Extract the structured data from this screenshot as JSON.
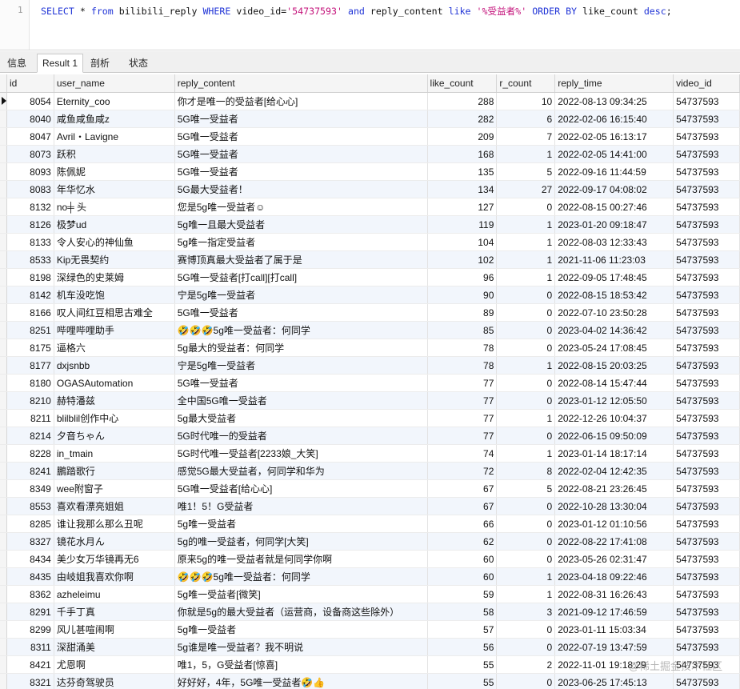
{
  "editor": {
    "line_number": "1",
    "sql": {
      "select": "SELECT",
      "star": " * ",
      "from": "from",
      "table": " bilibili_reply ",
      "where": "WHERE",
      "cond1": " video_id=",
      "vid": "'54737593'",
      "and": " and",
      "cond2": " reply_content ",
      "like": "like",
      "pattern": " '%受益者%'",
      "order": " ORDER BY",
      "orderby": " like_count ",
      "desc": "desc",
      "end": ";"
    }
  },
  "tabs": [
    "信息",
    "Result 1",
    "剖析",
    "状态"
  ],
  "active_tab": "Result 1",
  "columns": [
    "id",
    "user_name",
    "reply_content",
    "like_count",
    "r_count",
    "reply_time",
    "video_id"
  ],
  "rows": [
    [
      "8054",
      "Eternity_coo",
      "你才是唯一的受益者[给心心]",
      "288",
      "10",
      "2022-08-13 09:34:25",
      "54737593"
    ],
    [
      "8040",
      "咸鱼咸鱼咸z",
      "5G唯一受益者",
      "282",
      "6",
      "2022-02-06 16:15:40",
      "54737593"
    ],
    [
      "8047",
      "Avril・Lavigne",
      "5G唯一受益者",
      "209",
      "7",
      "2022-02-05 16:13:17",
      "54737593"
    ],
    [
      "8073",
      "跃积",
      "5G唯一受益者",
      "168",
      "1",
      "2022-02-05 14:41:00",
      "54737593"
    ],
    [
      "8093",
      "陈佩妮",
      "5G唯一受益者",
      "135",
      "5",
      "2022-09-16 11:44:59",
      "54737593"
    ],
    [
      "8083",
      "年华忆水",
      "5G最大受益者！",
      "134",
      "27",
      "2022-09-17 04:08:02",
      "54737593"
    ],
    [
      "8132",
      "no╪ 头",
      "您是5g唯一受益者☺",
      "127",
      "0",
      "2022-08-15 00:27:46",
      "54737593"
    ],
    [
      "8126",
      "极梦ud",
      "5g唯一且最大受益者",
      "119",
      "1",
      "2023-01-20 09:18:47",
      "54737593"
    ],
    [
      "8133",
      "令人安心的神仙鱼",
      "5g唯一指定受益者",
      "104",
      "1",
      "2022-08-03 12:33:43",
      "54737593"
    ],
    [
      "8533",
      "Kip无畏契约",
      "赛博顶真最大受益者了属于是",
      "102",
      "1",
      "2021-11-06 11:23:03",
      "54737593"
    ],
    [
      "8198",
      "深绿色的史莱姆",
      "5G唯一受益者[打call][打call]",
      "96",
      "1",
      "2022-09-05 17:48:45",
      "54737593"
    ],
    [
      "8142",
      "机车没吃饱",
      "宁是5g唯一受益者",
      "90",
      "0",
      "2022-08-15 18:53:42",
      "54737593"
    ],
    [
      "8166",
      "叹人间红豆相思古难全",
      "5G唯一受益者",
      "89",
      "0",
      "2022-07-10 23:50:28",
      "54737593"
    ],
    [
      "8251",
      "哔哩哔哩助手",
      "🤣🤣🤣5g唯一受益者：何同学",
      "85",
      "0",
      "2023-04-02 14:36:42",
      "54737593"
    ],
    [
      "8175",
      "逼格六",
      "5g最大的受益者：何同学",
      "78",
      "0",
      "2023-05-24 17:08:45",
      "54737593"
    ],
    [
      "8177",
      "dxjsnbb",
      "宁是5g唯一受益者",
      "78",
      "1",
      "2022-08-15 20:03:25",
      "54737593"
    ],
    [
      "8180",
      "OGASAutomation",
      "5G唯一受益者",
      "77",
      "0",
      "2022-08-14 15:47:44",
      "54737593"
    ],
    [
      "8210",
      "赫特潘兹",
      "全中国5G唯一受益者",
      "77",
      "0",
      "2023-01-12 12:05:50",
      "54737593"
    ],
    [
      "8211",
      "blilblil创作中心",
      "5g最大受益者",
      "77",
      "1",
      "2022-12-26 10:04:37",
      "54737593"
    ],
    [
      "8214",
      "夕音ちゃん",
      "5G时代唯一的受益者",
      "77",
      "0",
      "2022-06-15 09:50:09",
      "54737593"
    ],
    [
      "8228",
      "in_tmain",
      "5G时代唯一受益者[2233娘_大笑]",
      "74",
      "1",
      "2023-01-14 18:17:14",
      "54737593"
    ],
    [
      "8241",
      "鵬踏歌行",
      "感觉5G最大受益者，何同学和华为",
      "72",
      "8",
      "2022-02-04 12:42:35",
      "54737593"
    ],
    [
      "8349",
      "wee附窗子",
      "5G唯一受益者[给心心]",
      "67",
      "5",
      "2022-08-21 23:26:45",
      "54737593"
    ],
    [
      "8553",
      "喜欢看漂亮姐姐",
      "唯1！5！G受益者",
      "67",
      "0",
      "2022-10-28 13:30:04",
      "54737593"
    ],
    [
      "8285",
      "谁让我那么那么丑呢",
      "5g唯一受益者",
      "66",
      "0",
      "2023-01-12 01:10:56",
      "54737593"
    ],
    [
      "8327",
      "镜花水月ん",
      "5g的唯一受益者，何同学[大笑]",
      "62",
      "0",
      "2022-08-22 17:41:08",
      "54737593"
    ],
    [
      "8434",
      "美少女万华镜再无6",
      "原来5g的唯一受益者就是何同学你啊",
      "60",
      "0",
      "2023-05-26 02:31:47",
      "54737593"
    ],
    [
      "8435",
      "由岐姐我喜欢你啊",
      "🤣🤣🤣5g唯一受益者：何同学",
      "60",
      "1",
      "2023-04-18 09:22:46",
      "54737593"
    ],
    [
      "8362",
      "azheleimu",
      "5g唯一受益者[微笑]",
      "59",
      "1",
      "2022-08-31 16:26:43",
      "54737593"
    ],
    [
      "8291",
      "千手丁真",
      "你就是5g的最大受益者（运营商，设备商这些除外）",
      "58",
      "3",
      "2021-09-12 17:46:59",
      "54737593"
    ],
    [
      "8299",
      "风儿甚喧闹啊",
      "5g唯一受益者",
      "57",
      "0",
      "2023-01-11 15:03:34",
      "54737593"
    ],
    [
      "8311",
      "深甜涌美",
      "5g谁是唯一受益者？我不明说",
      "56",
      "0",
      "2022-07-19 13:47:59",
      "54737593"
    ],
    [
      "8421",
      "尤恩啊",
      "唯1，5，G受益者[惊喜]",
      "55",
      "2",
      "2022-11-01 19:18:29",
      "54737593"
    ],
    [
      "8321",
      "达芬奇驾驶员",
      "好好好，4年，5G唯一受益者🤣👍",
      "55",
      "0",
      "2023-06-25 17:45:13",
      "54737593"
    ]
  ],
  "watermark": "@稀土掘金技术社区"
}
